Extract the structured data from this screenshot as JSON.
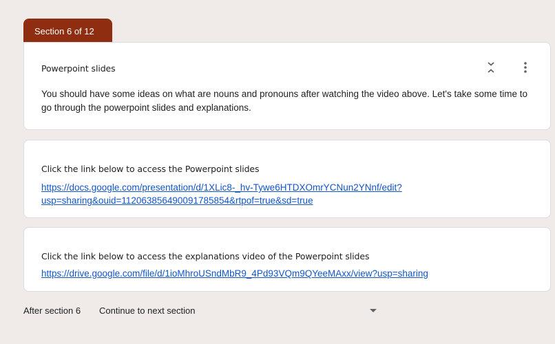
{
  "section_tab": "Section 6 of 12",
  "cards": {
    "intro": {
      "title": "Powerpoint slides",
      "description": "You should have some ideas on what are nouns and pronouns after watching the video above. Let's take some time to go through the powerpoint slides and explanations.",
      "icons": [
        "collapse-icon",
        "more-vert-icon"
      ]
    },
    "slides": {
      "title": "Click the link below to access the Powerpoint slides",
      "link": "https://docs.google.com/presentation/d/1XLic8-_hv-Tywe6HTDXOmrYCNun2YNnf/edit?usp=sharing&ouid=112063856490091785854&rtpof=true&sd=true"
    },
    "video": {
      "title": "Click the link below to access the explanations video of the Powerpoint slides",
      "link": "https://drive.google.com/file/d/1ioMhroUSndMbR9_4Pd93VQm9QYeeMAxx/view?usp=sharing"
    }
  },
  "after_section": {
    "label": "After section 6",
    "selected": "Continue to next section"
  },
  "colors": {
    "accent": "#8e2d10",
    "background": "#f0ebe8",
    "link": "#1155cc"
  }
}
